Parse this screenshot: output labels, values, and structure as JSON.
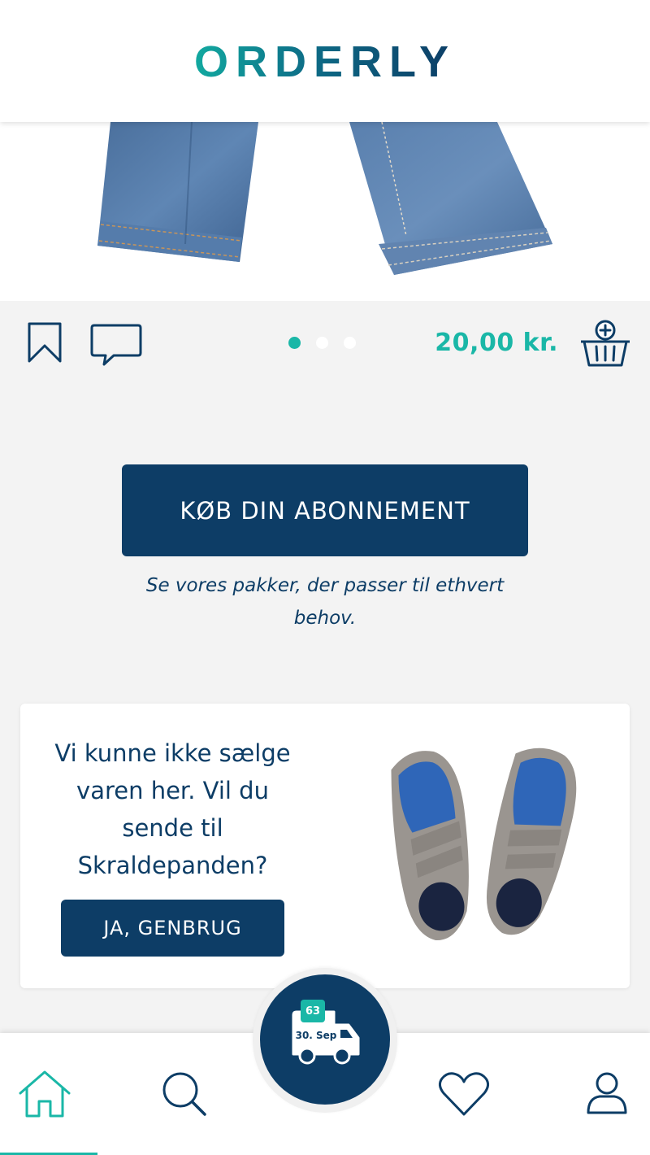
{
  "header": {
    "logo_text": "ORDERLY"
  },
  "product": {
    "image_alt": "Denim jeans",
    "price": "20,00 kr.",
    "carousel": {
      "total": 3,
      "active_index": 0
    }
  },
  "subscription": {
    "button_label": "KØB DIN ABONNEMENT",
    "subtitle": "Se vores pakker, der passer til ethvert behov."
  },
  "recycle_card": {
    "message": "Vi kunne ikke sælge varen her. Vil du sende til Skraldepanden?",
    "button_label": "JA, GENBRUG",
    "image_alt": "Blue and grey sneakers"
  },
  "delivery": {
    "count": "63",
    "date": "30. Sep"
  },
  "bottom_nav": {
    "items": [
      {
        "name": "home",
        "icon": "home-icon",
        "active": true
      },
      {
        "name": "search",
        "icon": "search-icon",
        "active": false
      },
      {
        "name": "favorites",
        "icon": "heart-icon",
        "active": false
      },
      {
        "name": "profile",
        "icon": "user-icon",
        "active": false
      }
    ]
  },
  "colors": {
    "primary": "#0d3d66",
    "accent": "#1ab7a7",
    "background": "#f3f3f3"
  }
}
